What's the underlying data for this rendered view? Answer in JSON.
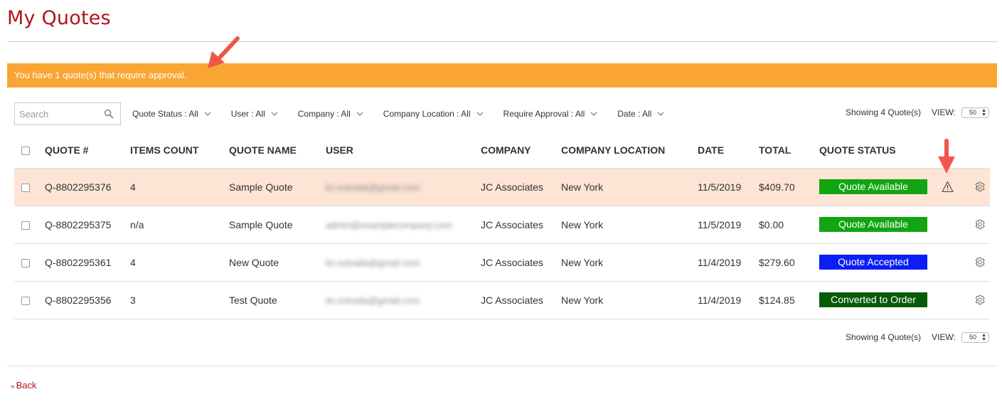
{
  "page": {
    "title": "My Quotes",
    "alert_message": "You have 1 quote(s) that require approval.",
    "back_link": "Back",
    "back_prefix": "«"
  },
  "search": {
    "placeholder": "Search"
  },
  "filters": [
    {
      "label": "Quote Status : All"
    },
    {
      "label": "User : All"
    },
    {
      "label": "Company : All"
    },
    {
      "label": "Company Location : All"
    },
    {
      "label": "Require Approval : All"
    },
    {
      "label": "Date : All"
    }
  ],
  "pager": {
    "showing": "Showing 4 Quote(s)",
    "view_label": "VIEW:",
    "view_value": "50"
  },
  "table": {
    "headers": [
      "QUOTE #",
      "ITEMS COUNT",
      "QUOTE NAME",
      "USER",
      "COMPANY",
      "COMPANY LOCATION",
      "DATE",
      "TOTAL",
      "QUOTE STATUS"
    ],
    "rows": [
      {
        "quote": "Q-8802295376",
        "items": "4",
        "name": "Sample Quote",
        "user": "lin.estrada@gmail.com",
        "company": "JC Associates",
        "location": "New York",
        "date": "11/5/2019",
        "total": "$409.70",
        "status": "Quote Available",
        "status_color": "#11a511",
        "requires_approval": true
      },
      {
        "quote": "Q-8802295375",
        "items": "n/a",
        "name": "Sample Quote",
        "user": "admin@examplecompany.com",
        "company": "JC Associates",
        "location": "New York",
        "date": "11/5/2019",
        "total": "$0.00",
        "status": "Quote Available",
        "status_color": "#11a511",
        "requires_approval": false
      },
      {
        "quote": "Q-8802295361",
        "items": "4",
        "name": "New Quote",
        "user": "lin.estrada@gmail.com",
        "company": "JC Associates",
        "location": "New York",
        "date": "11/4/2019",
        "total": "$279.60",
        "status": "Quote Accepted",
        "status_color": "#0a1ef5",
        "requires_approval": false
      },
      {
        "quote": "Q-8802295356",
        "items": "3",
        "name": "Test Quote",
        "user": "lin.estrada@gmail.com",
        "company": "JC Associates",
        "location": "New York",
        "date": "11/4/2019",
        "total": "$124.85",
        "status": "Converted to Order",
        "status_color": "#075a07",
        "requires_approval": false
      }
    ]
  },
  "colors": {
    "brand": "#b0151b",
    "alert_bg": "#f9a533",
    "highlight_row": "#fde4d4",
    "annotation_arrow": "#f0574a"
  },
  "icons": {
    "search": "search-icon",
    "filter_chevron": "chevron-down-icon",
    "approval": "warning-icon",
    "row_action": "gear-icon"
  }
}
